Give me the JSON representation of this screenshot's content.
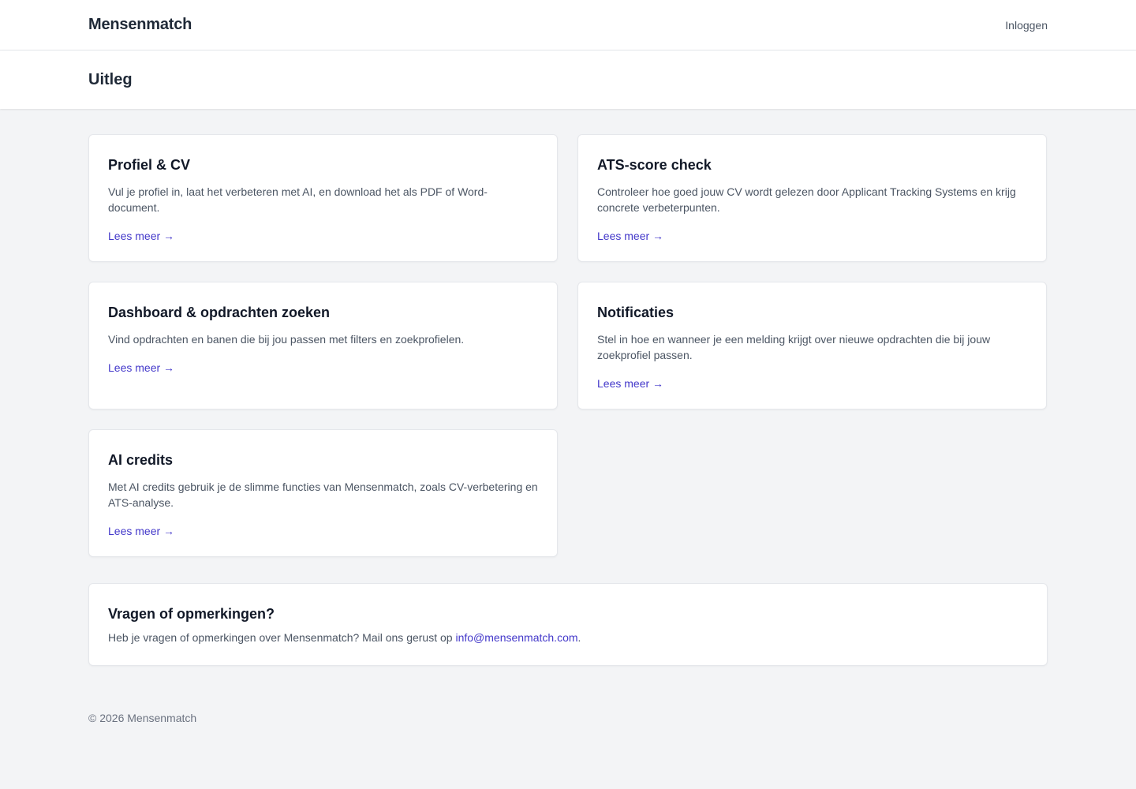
{
  "nav": {
    "brand": "Mensenmatch",
    "login": "Inloggen"
  },
  "header": {
    "title": "Uitleg"
  },
  "cards": [
    {
      "title": "Profiel & CV",
      "description": "Vul je profiel in, laat het verbeteren met AI, en download het als PDF of Word-document.",
      "link": "Lees meer →"
    },
    {
      "title": "ATS-score check",
      "description": "Controleer hoe goed jouw CV wordt gelezen door Applicant Tracking Systems en krijg concrete verbeterpunten.",
      "link": "Lees meer →"
    },
    {
      "title": "Dashboard & opdrachten zoeken",
      "description": "Vind opdrachten en banen die bij jou passen met filters en zoekprofielen.",
      "link": "Lees meer →"
    },
    {
      "title": "Notificaties",
      "description": "Stel in hoe en wanneer je een melding krijgt over nieuwe opdrachten die bij jouw zoekprofiel passen.",
      "link": "Lees meer →"
    },
    {
      "title": "AI credits",
      "description": "Met AI credits gebruik je de slimme functies van Mensenmatch, zoals CV-verbetering en ATS-analyse.",
      "link": "Lees meer →"
    }
  ],
  "contact": {
    "title": "Vragen of opmerkingen?",
    "text_before": "Heb je vragen of opmerkingen over Mensenmatch? Mail ons gerust op ",
    "email": "info@mensenmatch.com",
    "text_after": "."
  },
  "footer": {
    "copyright": "© 2026 Mensenmatch"
  },
  "colors": {
    "accent": "#4338ca",
    "background": "#f3f4f6",
    "card": "#ffffff",
    "text": "#111827",
    "muted": "#4b5563"
  }
}
